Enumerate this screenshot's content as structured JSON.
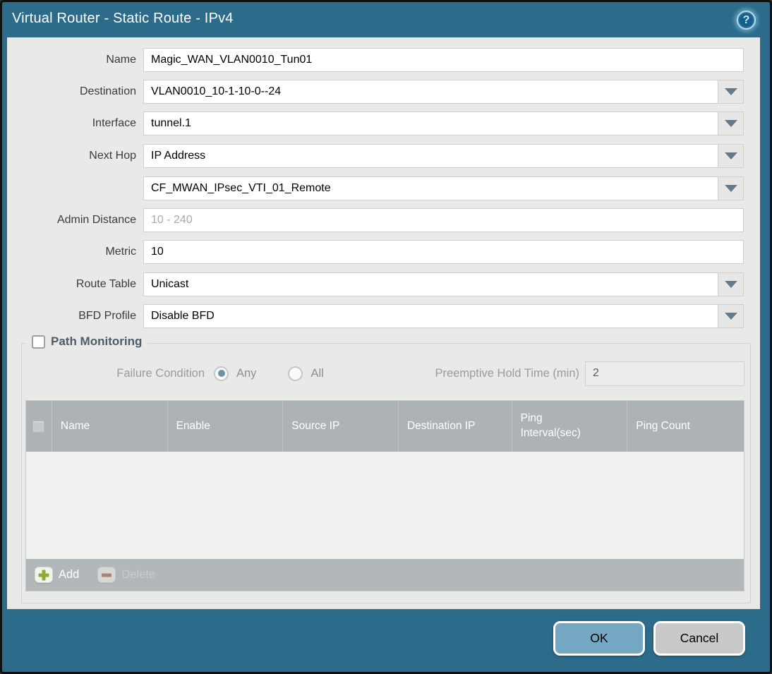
{
  "colors": {
    "titlebar_bg": "#2d6b8a",
    "panel_bg": "#e9e9e8",
    "table_header_bg": "#adb2b5",
    "ok_button_bg": "#74a7c1",
    "cancel_button_bg": "#c9c9c9",
    "add_icon_green": "#8fa93b",
    "delete_icon_red": "#a9553f",
    "radio_selected": "#6d93a8"
  },
  "dialog": {
    "title": "Virtual Router - Static Route - IPv4",
    "help_icon_glyph": "?",
    "ok_label": "OK",
    "cancel_label": "Cancel"
  },
  "form": {
    "name": {
      "label": "Name",
      "value": "Magic_WAN_VLAN0010_Tun01"
    },
    "destination": {
      "label": "Destination",
      "value": "VLAN0010_10-1-10-0--24"
    },
    "interface": {
      "label": "Interface",
      "value": "tunnel.1"
    },
    "next_hop": {
      "label": "Next Hop",
      "value": "IP Address"
    },
    "next_hop_address": {
      "label": "",
      "value": "CF_MWAN_IPsec_VTI_01_Remote"
    },
    "admin_distance": {
      "label": "Admin Distance",
      "value": "",
      "placeholder": "10 - 240"
    },
    "metric": {
      "label": "Metric",
      "value": "10"
    },
    "route_table": {
      "label": "Route Table",
      "value": "Unicast"
    },
    "bfd_profile": {
      "label": "BFD Profile",
      "value": "Disable BFD"
    }
  },
  "path_monitoring": {
    "title": "Path Monitoring",
    "enabled": false,
    "failure_condition": {
      "label": "Failure Condition",
      "options": [
        {
          "label": "Any",
          "selected": true
        },
        {
          "label": "All",
          "selected": false
        }
      ]
    },
    "preemptive_hold_time": {
      "label": "Preemptive Hold Time (min)",
      "value": "2"
    },
    "table": {
      "columns": [
        "Name",
        "Enable",
        "Source IP",
        "Destination IP",
        "Ping Interval(sec)",
        "Ping Count"
      ],
      "rows": []
    },
    "add_label": "Add",
    "delete_label": "Delete"
  }
}
